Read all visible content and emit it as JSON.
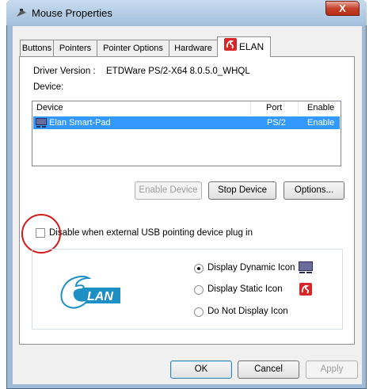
{
  "window": {
    "title": "Mouse Properties",
    "close_symbol": "X"
  },
  "tabs": [
    {
      "label": "Buttons"
    },
    {
      "label": "Pointers"
    },
    {
      "label": "Pointer Options"
    },
    {
      "label": "Hardware"
    },
    {
      "label": "ELAN",
      "active": true
    }
  ],
  "driver": {
    "label": "Driver Version :",
    "value": "ETDWare PS/2-X64 8.0.5.0_WHQL"
  },
  "device_section_label": "Device:",
  "device_table": {
    "columns": [
      "Device",
      "Port",
      "Enable"
    ],
    "rows": [
      {
        "device": "Elan Smart-Pad",
        "port": "PS/2",
        "enable": "Enable",
        "selected": true
      }
    ]
  },
  "device_buttons": {
    "enable": "Enable Device",
    "stop": "Stop Device",
    "options": "Options..."
  },
  "disable_usb_label": "Disable when external USB pointing device plug in",
  "disable_usb_checked": false,
  "logo_text": "LAN",
  "icon_options": [
    {
      "label": "Display Dynamic Icon",
      "selected": true,
      "icon": "touchpad-icon"
    },
    {
      "label": "Display Static Icon",
      "selected": false,
      "icon": "elan-logo-icon"
    },
    {
      "label": "Do Not Display Icon",
      "selected": false
    }
  ],
  "footer": {
    "ok": "OK",
    "cancel": "Cancel",
    "apply": "Apply"
  },
  "colors": {
    "accent_red": "#d11a1a",
    "selection_blue": "#3399ff",
    "elan_blue": "#1c8fc4"
  }
}
